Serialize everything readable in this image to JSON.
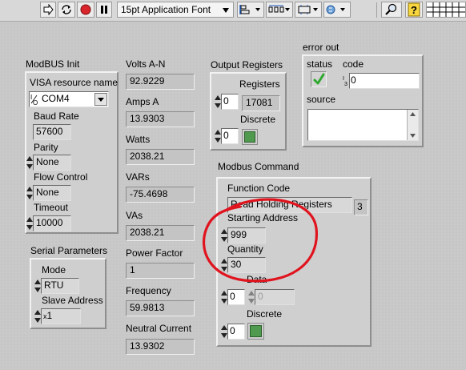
{
  "toolbar": {
    "font_label": "15pt Application Font",
    "icons": [
      "run-arrow-icon",
      "run-continuously-icon",
      "abort-icon",
      "pause-icon",
      "align-icon",
      "distribute-icon",
      "resize-icon",
      "reorder-icon",
      "search-icon",
      "help-icon",
      "grid-icon"
    ]
  },
  "modbus_init": {
    "title": "ModBUS Init",
    "visa_label": "VISA resource name",
    "visa_value": "COM4",
    "baud_label": "Baud Rate",
    "baud_value": "57600",
    "parity_label": "Parity",
    "parity_value": "None",
    "flow_label": "Flow Control",
    "flow_value": "None",
    "timeout_label": "Timeout",
    "timeout_value": "10000"
  },
  "serial_params": {
    "title": "Serial Parameters",
    "mode_label": "Mode",
    "mode_value": "RTU",
    "slave_label": "Slave Address",
    "slave_prefix": "x",
    "slave_value": "1"
  },
  "meters": [
    {
      "label": "Volts A-N",
      "value": "92.9229"
    },
    {
      "label": "Amps A",
      "value": "13.9303"
    },
    {
      "label": "Watts",
      "value": "2038.21"
    },
    {
      "label": "VARs",
      "value": "-75.4698"
    },
    {
      "label": "VAs",
      "value": "2038.21"
    },
    {
      "label": "Power Factor",
      "value": "1"
    },
    {
      "label": "Frequency",
      "value": "59.9813"
    },
    {
      "label": "Neutral Current",
      "value": "13.9302"
    }
  ],
  "output_registers": {
    "title": "Output Registers",
    "registers_label": "Registers",
    "reg_index": "0",
    "reg_value": "17081",
    "discrete_label": "Discrete",
    "disc_index": "0",
    "led_color": "#4f9a4f"
  },
  "error_out": {
    "title": "error out",
    "status_label": "status",
    "code_label": "code",
    "code_value": "0",
    "source_label": "source",
    "status_color": "#2fa82f"
  },
  "modbus_command": {
    "title": "Modbus Command",
    "function_label": "Function Code",
    "function_value": "Read Holding Registers",
    "function_number": "3",
    "start_label": "Starting Address",
    "start_value": "999",
    "quantity_label": "Quantity",
    "quantity_value": "30",
    "data_label": "Data",
    "data_index": "0",
    "data_value": "0",
    "discrete_label": "Discrete",
    "disc_index": "0",
    "led_color": "#4f9a4f",
    "annotation_color": "#e0141e"
  }
}
